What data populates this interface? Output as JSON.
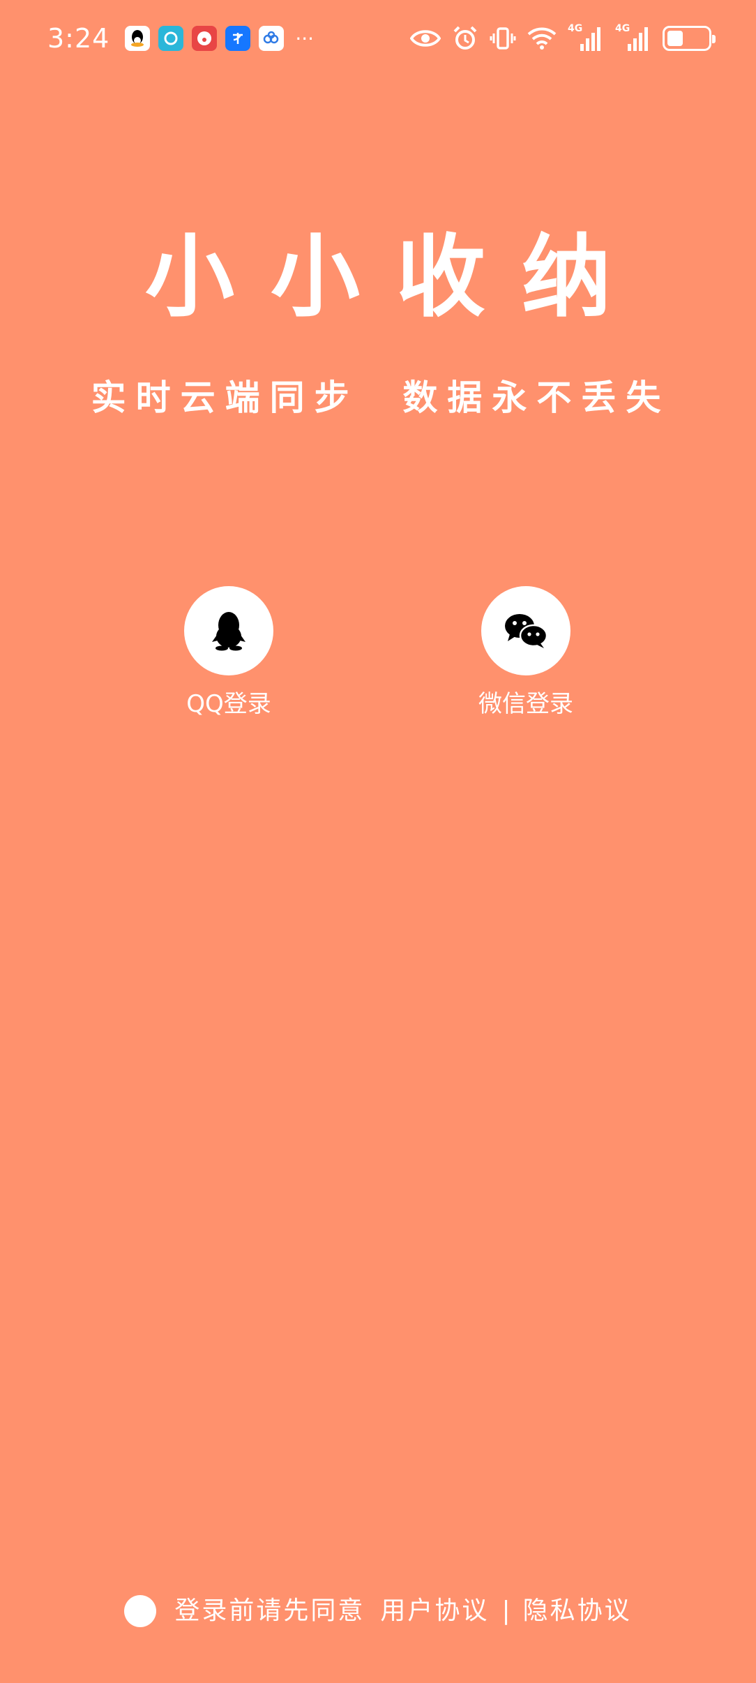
{
  "status_bar": {
    "time": "3:24",
    "notification_icons": [
      "qq-icon",
      "cyan-app-icon",
      "clown-app-icon",
      "alipay-icon",
      "cloud-app-icon"
    ],
    "more": "···",
    "network_1": "4G",
    "network_2": "4G",
    "battery_level_percent": 40
  },
  "header": {
    "title": "小小收纳",
    "subtitle": "实时云端同步  数据永不丢失"
  },
  "login": {
    "qq_label": "QQ登录",
    "wechat_label": "微信登录"
  },
  "agreement": {
    "prefix": "登录前请先同意",
    "user_agreement": "用户协议",
    "separator": "|",
    "privacy_agreement": "隐私协议"
  },
  "colors": {
    "background": "#FF916D",
    "foreground": "#FFFFFF",
    "icon": "#000000"
  }
}
